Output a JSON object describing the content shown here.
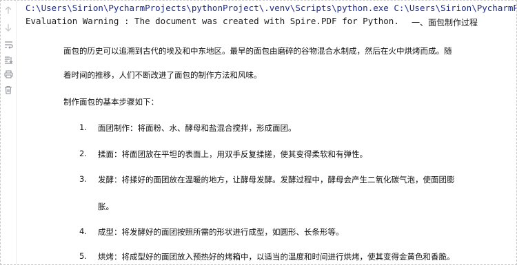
{
  "console": {
    "command_line": "C:\\Users\\Sirion\\PycharmProjects\\pythonProject\\.venv\\Scripts\\python.exe C:\\Users\\Sirion\\PycharmProjects\\",
    "warning_line": "Evaluation Warning : The document was created with Spire.PDF for Python.",
    "section_title": "一、面包制作过程",
    "intro_line1": "面包的历史可以追溯到古代的埃及和中东地区。最早的面包由磨碎的谷物混合水制成，然后在火中烘烤而成。随",
    "intro_line2": "着时间的推移，人们不断改进了面包的制作方法和风味。",
    "steps_heading": "制作面包的基本步骤如下：",
    "steps": [
      {
        "num": "1.",
        "text": "面团制作：将面粉、水、酵母和盐混合搅拌，形成面团。"
      },
      {
        "num": "2.",
        "text": "揉面：将面团放在平坦的表面上，用双手反复揉搓，使其变得柔软和有弹性。"
      },
      {
        "num": "3.",
        "text": "发酵：将揉好的面团放在温暖的地方，让酵母发酵。发酵过程中，酵母会产生二氧化碳气泡，使面团膨",
        "cont": "胀。"
      },
      {
        "num": "4.",
        "text": "成型：将发酵好的面团按照所需的形状进行成型，如圆形、长条形等。"
      },
      {
        "num": "5.",
        "text": "烘烤：将成型好的面团放入预热好的烤箱中，以适当的温度和时间进行烘烤，使其变得金黄色和香脆。"
      }
    ]
  },
  "toolbar": {
    "icons": [
      "arrow-up-icon",
      "arrow-down-icon",
      "soft-wrap-icon",
      "scroll-to-end-icon",
      "print-icon",
      "trash-icon"
    ]
  },
  "colors": {
    "command_text": "#1b2a8c",
    "body_text": "#111111",
    "gutter_icon": "#9aa0a6"
  }
}
